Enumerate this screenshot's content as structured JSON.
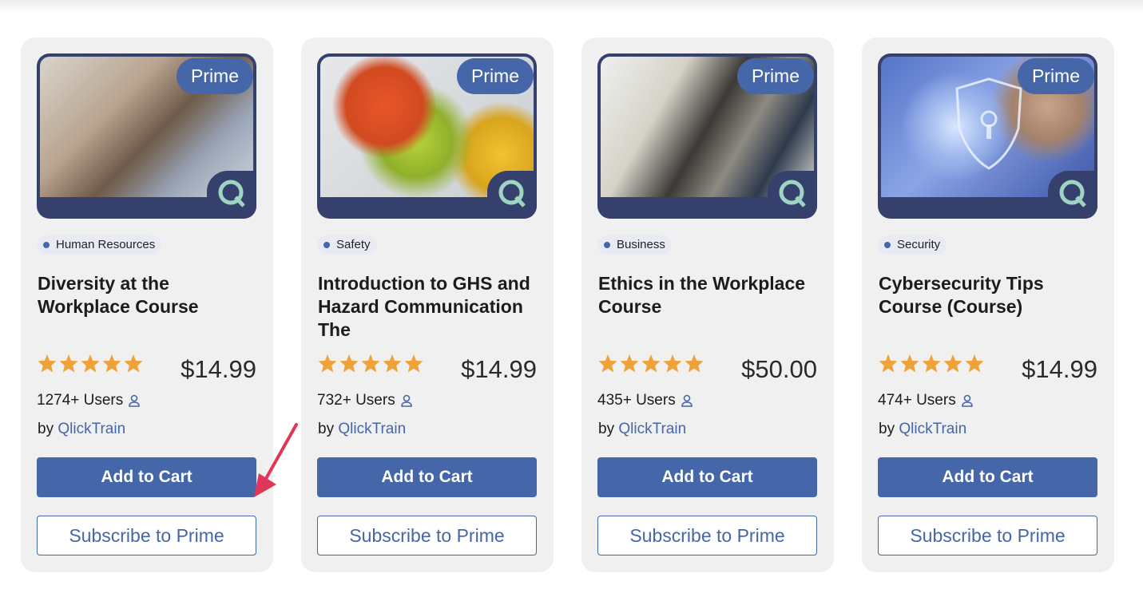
{
  "badge_label": "Prime",
  "colors": {
    "accent": "#4566a8",
    "star": "#f0a23a",
    "card_bg": "#f0f0f1",
    "thumb_frame": "#36406c",
    "arrow": "#e0365a"
  },
  "courses": [
    {
      "category": "Human Resources",
      "title": "Diversity at the Workplace Course",
      "price": "$14.99",
      "users": "1274+ Users",
      "by": "by",
      "author": "QlickTrain",
      "cart_label": "Add to Cart",
      "subscribe_label": "Subscribe to Prime",
      "rating": 5
    },
    {
      "category": "Safety",
      "title": "Introduction to GHS and Hazard Communication The",
      "price": "$14.99",
      "users": "732+ Users",
      "by": "by",
      "author": "QlickTrain",
      "cart_label": "Add to Cart",
      "subscribe_label": "Subscribe to Prime",
      "rating": 5
    },
    {
      "category": "Business",
      "title": "Ethics in the Workplace Course",
      "price": "$50.00",
      "users": "435+ Users",
      "by": "by",
      "author": "QlickTrain",
      "cart_label": "Add to Cart",
      "subscribe_label": "Subscribe to Prime",
      "rating": 5
    },
    {
      "category": "Security",
      "title": "Cybersecurity Tips Course (Course)",
      "price": "$14.99",
      "users": "474+ Users",
      "by": "by",
      "author": "QlickTrain",
      "cart_label": "Add to Cart",
      "subscribe_label": "Subscribe to Prime",
      "rating": 5
    }
  ]
}
